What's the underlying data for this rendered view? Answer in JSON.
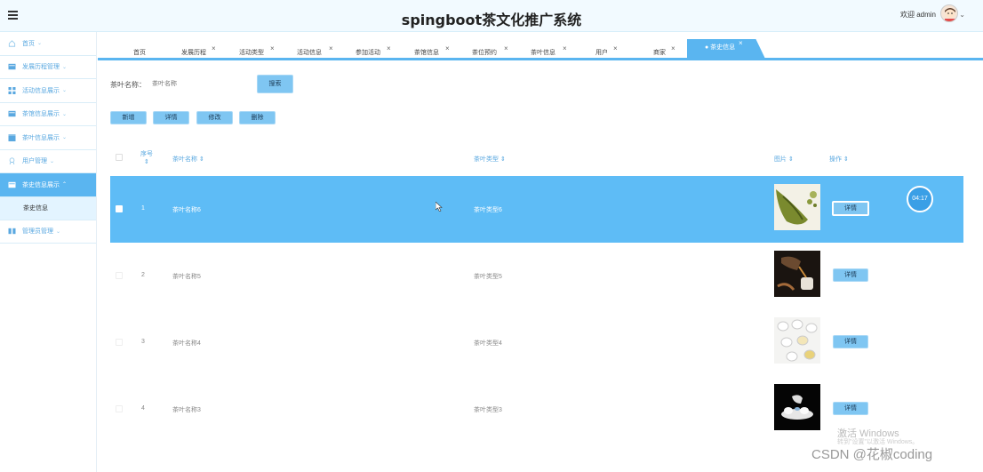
{
  "header": {
    "title": "spingboot茶文化推广系统",
    "welcome": "欢迎 admin",
    "caret": "⌄"
  },
  "sidebar": {
    "items": [
      {
        "label": "首页",
        "chev": "⌄"
      },
      {
        "label": "发展历程管理",
        "chev": "⌄"
      },
      {
        "label": "活动信息展示",
        "chev": "⌄"
      },
      {
        "label": "茶馆信息展示",
        "chev": "⌄"
      },
      {
        "label": "茶叶信息展示",
        "chev": "⌄"
      },
      {
        "label": "用户管理",
        "chev": "⌄"
      },
      {
        "label": "茶史信息展示",
        "chev": "⌃"
      },
      {
        "label": "管理员管理",
        "chev": "⌄"
      }
    ],
    "sub_item": "茶史信息"
  },
  "tabs": [
    {
      "label": "首页",
      "close": ""
    },
    {
      "label": "发展历程",
      "close": "×"
    },
    {
      "label": "活动类型",
      "close": "×"
    },
    {
      "label": "活动信息",
      "close": "×"
    },
    {
      "label": "参加活动",
      "close": "×"
    },
    {
      "label": "茶馆信息",
      "close": "×"
    },
    {
      "label": "茶位预约",
      "close": "×"
    },
    {
      "label": "茶叶信息",
      "close": "×"
    },
    {
      "label": "用户",
      "close": "×"
    },
    {
      "label": "商家",
      "close": "×"
    },
    {
      "label": "● 茶史信息",
      "close": "×"
    }
  ],
  "search": {
    "label": "茶叶名称：",
    "placeholder": "茶叶名称",
    "button": "搜索"
  },
  "actions": {
    "add": "新增",
    "detail": "详情",
    "edit": "修改",
    "delete": "删除"
  },
  "table": {
    "columns": {
      "index": "序号",
      "name": "茶叶名称",
      "type": "茶叶类型",
      "image": "图片",
      "action": "操作"
    },
    "sort_icon": "⇕",
    "rows": [
      {
        "index": "1",
        "name": "茶叶名称6",
        "type": "茶叶类型6",
        "action": "详情"
      },
      {
        "index": "2",
        "name": "茶叶名称5",
        "type": "茶叶类型5",
        "action": "详情"
      },
      {
        "index": "3",
        "name": "茶叶名称4",
        "type": "茶叶类型4",
        "action": "详情"
      },
      {
        "index": "4",
        "name": "茶叶名称3",
        "type": "茶叶类型3",
        "action": "详情"
      }
    ]
  },
  "overlay": {
    "timer": "04:17",
    "watermark": "激活 Windows",
    "watermark_sub": "转到\"设置\"以激活 Windows。",
    "csdn": "CSDN @花椒coding"
  },
  "colors": {
    "accent": "#5ab5f0",
    "selected_row": "#5ebcf6",
    "button": "#7fc6f2"
  }
}
